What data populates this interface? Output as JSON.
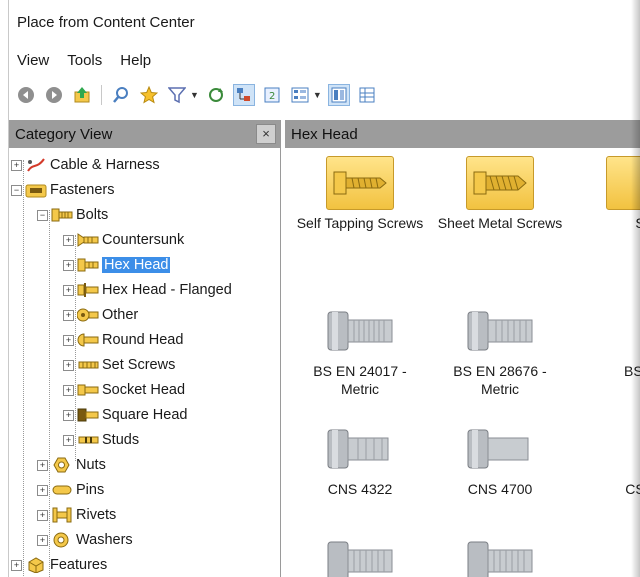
{
  "window": {
    "title": "Place from Content Center"
  },
  "menu": {
    "items": [
      "View",
      "Tools",
      "Help"
    ]
  },
  "toolbar": {
    "buttons": [
      "back-icon",
      "forward-icon",
      "up-level-icon",
      "search-icon",
      "favorites-icon",
      "filter-icon",
      "refresh-icon",
      "tree-view-icon",
      "update-icon",
      "view-options-icon",
      "details-view-icon",
      "table-view-icon"
    ]
  },
  "left_pane": {
    "header": "Category View",
    "close": "×",
    "tree": [
      {
        "label": "Cable & Harness"
      },
      {
        "label": "Fasteners"
      },
      {
        "label": "Bolts"
      },
      {
        "label": "Countersunk"
      },
      {
        "label": "Hex Head"
      },
      {
        "label": "Hex Head - Flanged"
      },
      {
        "label": "Other"
      },
      {
        "label": "Round Head"
      },
      {
        "label": "Set Screws"
      },
      {
        "label": "Socket Head"
      },
      {
        "label": "Square Head"
      },
      {
        "label": "Studs"
      },
      {
        "label": "Nuts"
      },
      {
        "label": "Pins"
      },
      {
        "label": "Rivets"
      },
      {
        "label": "Washers"
      },
      {
        "label": "Features"
      }
    ]
  },
  "right_pane": {
    "header": "Hex Head",
    "items": [
      {
        "line1": "Self Tapping Screws",
        "line2": ""
      },
      {
        "line1": "Sheet Metal Screws",
        "line2": ""
      },
      {
        "line1": "S",
        "line2": ""
      },
      {
        "line1": "BS EN 24017 -",
        "line2": "Metric"
      },
      {
        "line1": "BS EN 28676 -",
        "line2": "Metric"
      },
      {
        "line1": "BS E",
        "line2": ""
      },
      {
        "line1": "CNS 4322",
        "line2": ""
      },
      {
        "line1": "CNS 4700",
        "line2": ""
      },
      {
        "line1": "CSN",
        "line2": ""
      }
    ]
  },
  "colors": {
    "selection": "#3c8ee8",
    "header_bg": "#9c9c9c",
    "folder": "#f2c240"
  }
}
